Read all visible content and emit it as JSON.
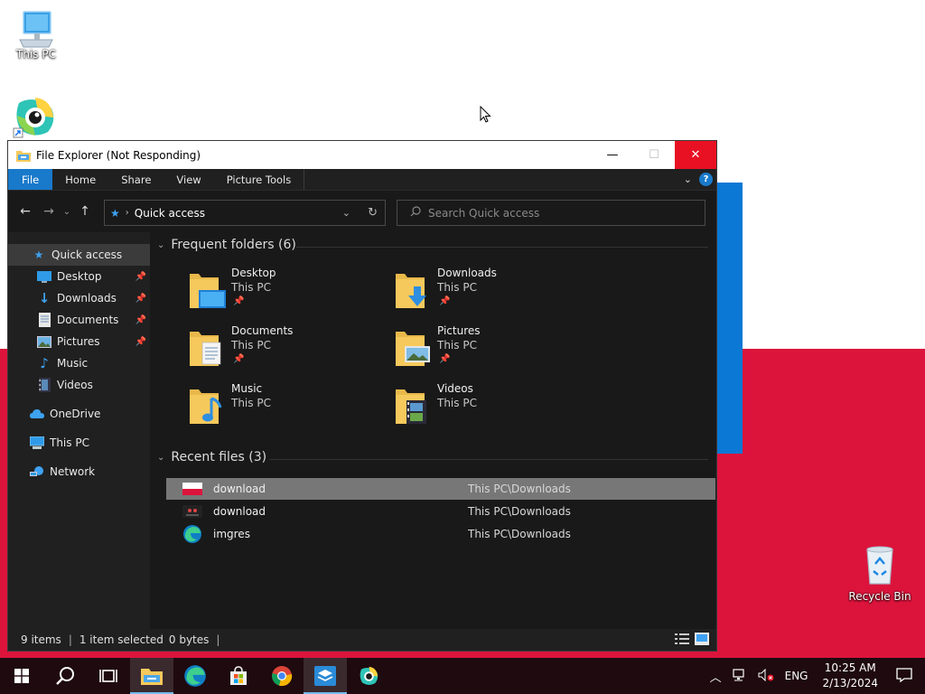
{
  "desktop": {
    "this_pc_label": "This PC",
    "recycle_bin_label": "Recycle Bin"
  },
  "window": {
    "title": "File Explorer (Not Responding)",
    "minimize": "—",
    "maximize": "☐",
    "close": "✕"
  },
  "ribbon": {
    "tabs": [
      "File",
      "Home",
      "Share",
      "View",
      "Picture Tools"
    ]
  },
  "address": {
    "crumb": "Quick access",
    "search_placeholder": "Search Quick access"
  },
  "sidebar": {
    "items": [
      {
        "label": "Quick access",
        "icon": "star-icon"
      },
      {
        "label": "Desktop",
        "icon": "desktop-icon",
        "pinned": true
      },
      {
        "label": "Downloads",
        "icon": "download-arrow-icon",
        "pinned": true
      },
      {
        "label": "Documents",
        "icon": "document-icon",
        "pinned": true
      },
      {
        "label": "Pictures",
        "icon": "pictures-icon",
        "pinned": true
      },
      {
        "label": "Music",
        "icon": "music-note-icon"
      },
      {
        "label": "Videos",
        "icon": "film-icon"
      },
      {
        "label": "OneDrive",
        "icon": "cloud-icon"
      },
      {
        "label": "This PC",
        "icon": "computer-icon"
      },
      {
        "label": "Network",
        "icon": "network-icon"
      }
    ]
  },
  "frequent": {
    "header": "Frequent folders (6)",
    "folders": [
      {
        "name": "Desktop",
        "location": "This PC",
        "pinned": true
      },
      {
        "name": "Downloads",
        "location": "This PC",
        "pinned": true
      },
      {
        "name": "Documents",
        "location": "This PC",
        "pinned": true
      },
      {
        "name": "Pictures",
        "location": "This PC",
        "pinned": true
      },
      {
        "name": "Music",
        "location": "This PC",
        "pinned": false
      },
      {
        "name": "Videos",
        "location": "This PC",
        "pinned": false
      }
    ]
  },
  "recent": {
    "header": "Recent files (3)",
    "files": [
      {
        "name": "download",
        "path": "This PC\\Downloads",
        "selected": true
      },
      {
        "name": "download",
        "path": "This PC\\Downloads",
        "selected": false
      },
      {
        "name": "imgres",
        "path": "This PC\\Downloads",
        "selected": false
      }
    ]
  },
  "status": {
    "items": "9 items",
    "selected": "1 item selected",
    "size": "0 bytes"
  },
  "tray": {
    "lang": "ENG",
    "time": "10:25 AM",
    "date": "2/13/2024"
  },
  "colors": {
    "accent": "#1979ca",
    "close_red": "#e81123",
    "flag_red": "#dc143c",
    "folder_yellow": "#f6c95c"
  }
}
